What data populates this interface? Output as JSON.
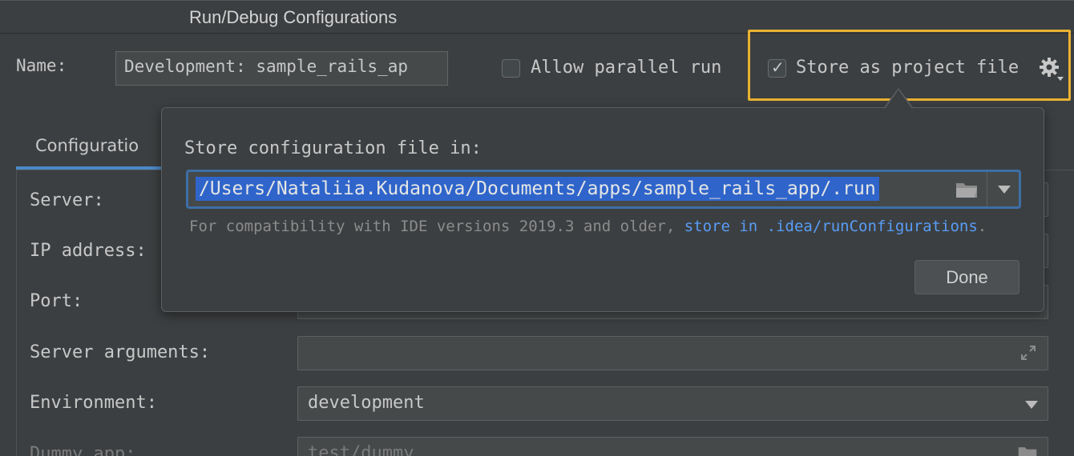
{
  "window": {
    "title": "Run/Debug Configurations"
  },
  "header": {
    "name_label": "Name:",
    "name_value": "Development: sample_rails_ap",
    "allow_parallel_label": "Allow parallel run",
    "allow_parallel_checked": false,
    "store_project_label": "Store as project file",
    "store_project_checked": true,
    "checkmark": "✓"
  },
  "tabs": [
    {
      "label": "Configuratio"
    }
  ],
  "form": {
    "server_label": "Server:",
    "ip_label": "IP address:",
    "port_label": "Port:",
    "server_args_label": "Server arguments:",
    "environment_label": "Environment:",
    "environment_value": "development",
    "dummy_label": "Dummy app:",
    "dummy_value": "test/dummy"
  },
  "popup": {
    "heading": "Store configuration file in:",
    "path": "/Users/Nataliia.Kudanova/Documents/apps/sample_rails_app/.run",
    "note_prefix": "For compatibility with IDE versions 2019.3 and older, ",
    "note_link": "store in .idea/runConfigurations",
    "note_suffix": ".",
    "done_label": "Done"
  },
  "colors": {
    "background": "#3c3f41",
    "highlight": "#e9b232",
    "selection": "#2f65ca",
    "link": "#589df6",
    "tab_underline": "#4a88c7"
  },
  "icons": [
    "checkmark-icon",
    "gear-icon",
    "folder-icon",
    "chevron-down-icon",
    "expand-icon"
  ]
}
